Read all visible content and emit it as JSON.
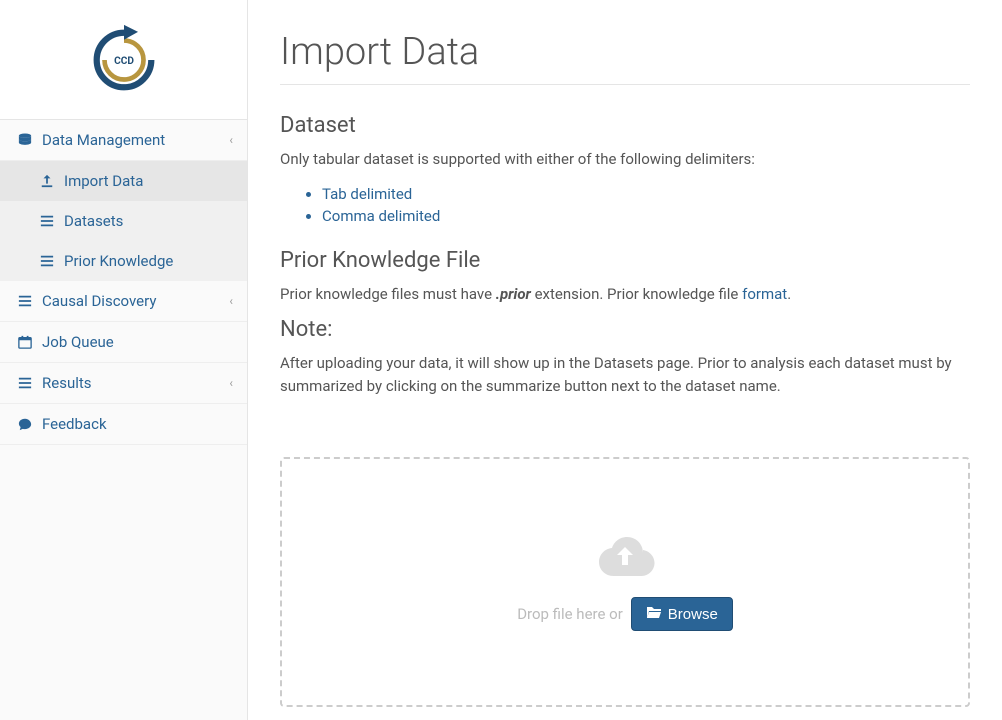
{
  "sidebar": {
    "items": [
      {
        "label": "Data Management",
        "expandable": true
      },
      {
        "label": "Causal Discovery",
        "expandable": true
      },
      {
        "label": "Job Queue",
        "expandable": false
      },
      {
        "label": "Results",
        "expandable": true
      },
      {
        "label": "Feedback",
        "expandable": false
      }
    ],
    "subitems": [
      {
        "label": "Import Data"
      },
      {
        "label": "Datasets"
      },
      {
        "label": "Prior Knowledge"
      }
    ]
  },
  "main": {
    "title": "Import Data",
    "dataset": {
      "heading": "Dataset",
      "text": "Only tabular dataset is supported with either of the following delimiters:",
      "bullets": [
        "Tab delimited",
        "Comma delimited"
      ]
    },
    "prior": {
      "heading": "Prior Knowledge File",
      "text_prefix": "Prior knowledge files must have ",
      "ext": ".prior",
      "text_mid": " extension. Prior knowledge file ",
      "link": "format",
      "text_suffix": "."
    },
    "note": {
      "heading": "Note:",
      "text": "After uploading your data, it will show up in the Datasets page. Prior to analysis each dataset must by summarized by clicking on the summarize button next to the dataset name."
    },
    "dropzone": {
      "text": "Drop file here or",
      "browse": "Browse"
    }
  }
}
